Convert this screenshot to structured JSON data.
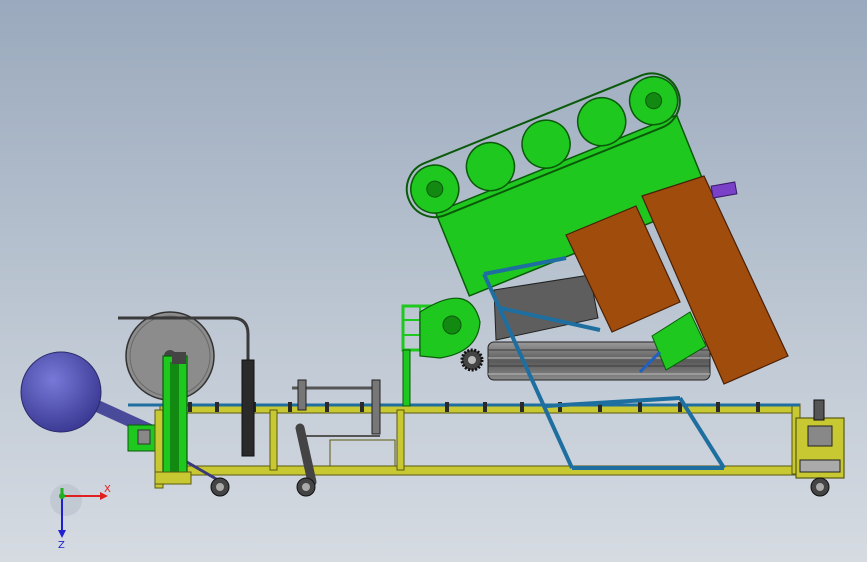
{
  "triad": {
    "x_label": "X",
    "z_label": "Z"
  },
  "colors": {
    "frame": "#c8c832",
    "frame_dark": "#5a5a10",
    "green": "#1ec81e",
    "green_dark": "#0a5a0a",
    "brown": "#a04c0c",
    "brown_dark": "#4a2006",
    "blue_frame": "#1e6fa0",
    "blue_sphere": "#5050b4",
    "gray": "#7a7a7a",
    "gray_dark": "#3a3a3a",
    "purple": "#7a40c8",
    "axis_x": "#e02020",
    "axis_y": "#20b020",
    "axis_z": "#2020d0"
  },
  "icons": [
    "coordinate-triad-icon"
  ]
}
